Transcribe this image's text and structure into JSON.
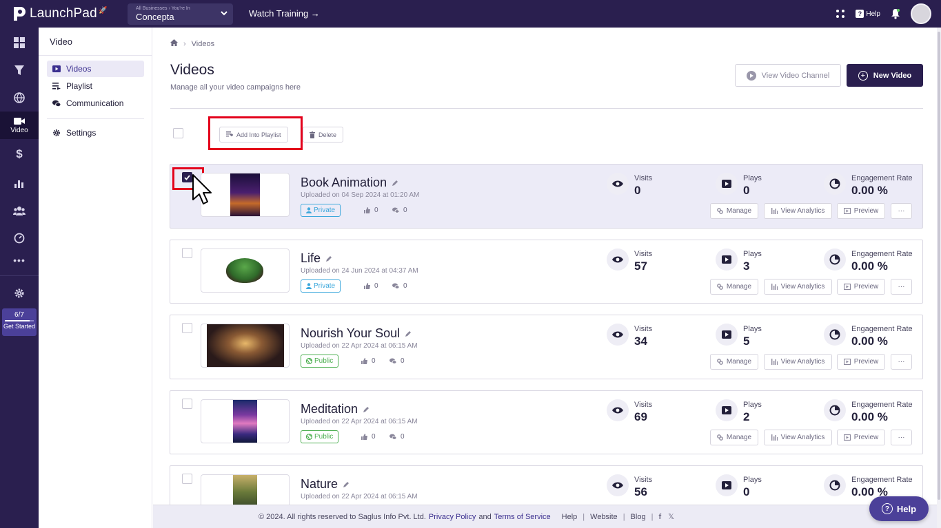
{
  "topbar": {
    "logo_text": "LaunchPad",
    "business_caption": "All Businesses › You're In",
    "business_name": "Concepta",
    "watch_training": "Watch Training →",
    "help_label": "Help"
  },
  "rail": {
    "video_label": "Video",
    "progress_fraction": "6/7",
    "progress_value": 0.857,
    "get_started": "Get Started"
  },
  "sidebar": {
    "title": "Video",
    "items": [
      {
        "label": "Videos",
        "icon": "video-icon",
        "active": true
      },
      {
        "label": "Playlist",
        "icon": "playlist-icon",
        "active": false
      },
      {
        "label": "Communication",
        "icon": "chat-icon",
        "active": false
      },
      {
        "label": "Settings",
        "icon": "gear-icon",
        "active": false
      }
    ]
  },
  "breadcrumb": {
    "current": "Videos"
  },
  "header": {
    "title": "Videos",
    "subtitle": "Manage all your video campaigns here",
    "view_channel_label": "View Video Channel",
    "new_video_label": "New Video"
  },
  "toolbar": {
    "add_playlist_label": "Add Into Playlist",
    "delete_label": "Delete"
  },
  "labels": {
    "visits": "Visits",
    "plays": "Plays",
    "engagement": "Engagement Rate",
    "manage": "Manage",
    "view_analytics": "View Analytics",
    "preview": "Preview",
    "more": "···"
  },
  "videos": [
    {
      "title": "Book Animation",
      "uploaded": "Uploaded on 04 Sep 2024 at 01:20 AM",
      "visibility": "Private",
      "likes": "0",
      "comments": "0",
      "visits": "0",
      "plays": "0",
      "engagement": "0.00 %",
      "checked": true
    },
    {
      "title": "Life",
      "uploaded": "Uploaded on 24 Jun 2024 at 04:37 AM",
      "visibility": "Private",
      "likes": "0",
      "comments": "0",
      "visits": "57",
      "plays": "3",
      "engagement": "0.00 %",
      "checked": false
    },
    {
      "title": "Nourish Your Soul",
      "uploaded": "Uploaded on 22 Apr 2024 at 06:15 AM",
      "visibility": "Public",
      "likes": "0",
      "comments": "0",
      "visits": "34",
      "plays": "5",
      "engagement": "0.00 %",
      "checked": false
    },
    {
      "title": "Meditation",
      "uploaded": "Uploaded on 22 Apr 2024 at 06:15 AM",
      "visibility": "Public",
      "likes": "0",
      "comments": "0",
      "visits": "69",
      "plays": "2",
      "engagement": "0.00 %",
      "checked": false
    },
    {
      "title": "Nature",
      "uploaded": "Uploaded on 22 Apr 2024 at 06:15 AM",
      "visibility": "",
      "likes": "",
      "comments": "",
      "visits": "56",
      "plays": "0",
      "engagement": "0.00 %",
      "checked": false
    }
  ],
  "footer": {
    "copyright": "© 2024. All rights reserved to Saglus Info Pvt. Ltd.",
    "privacy": "Privacy Policy",
    "and": "and",
    "terms": "Terms of Service",
    "help": "Help",
    "website": "Website",
    "blog": "Blog"
  },
  "help_button_label": "Help",
  "colors": {
    "brand_dark": "#2a1f4f",
    "accent": "#4b4099",
    "private": "#3da8dc",
    "public": "#4caf50",
    "highlight": "#e3001b"
  }
}
